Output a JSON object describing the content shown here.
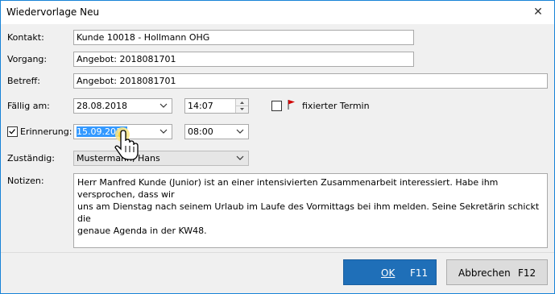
{
  "window": {
    "title": "Wiedervorlage Neu",
    "close_glyph": "✕"
  },
  "form": {
    "kontakt": {
      "label": "Kontakt:",
      "value": "Kunde 10018 - Hollmann OHG"
    },
    "vorgang": {
      "label": "Vorgang:",
      "value": "Angebot: 2018081701"
    },
    "betreff": {
      "label": "Betreff:",
      "value": "Angebot: 2018081701"
    },
    "faellig": {
      "label": "Fällig am:",
      "date": "28.08.2018",
      "time": "14:07"
    },
    "fixiert": {
      "label": "fixierter Termin",
      "checked": false,
      "flag_color": "#d00000"
    },
    "erinnerung": {
      "label": "Erinnerung:",
      "checked": true,
      "date": "15.09.2018",
      "time": "08:00"
    },
    "zustaendig": {
      "label": "Zuständig:",
      "value": "Mustermann, Hans"
    },
    "notizen": {
      "label": "Notizen:",
      "value": "Herr Manfred Kunde (Junior) ist an einer intensivierten Zusammenarbeit interessiert. Habe ihm versprochen, dass wir\nuns am Dienstag nach seinem Urlaub im Laufe des Vormittags bei ihm melden. Seine Sekretärin schickt die\ngenaue Agenda in der KW48."
    }
  },
  "buttons": {
    "ok": {
      "label": "OK",
      "key": "F11",
      "color": "#1f6fb8"
    },
    "cancel": {
      "label": "Abbrechen",
      "key": "F12"
    }
  },
  "cursor": {
    "icon": "hand-pointer-icon"
  }
}
